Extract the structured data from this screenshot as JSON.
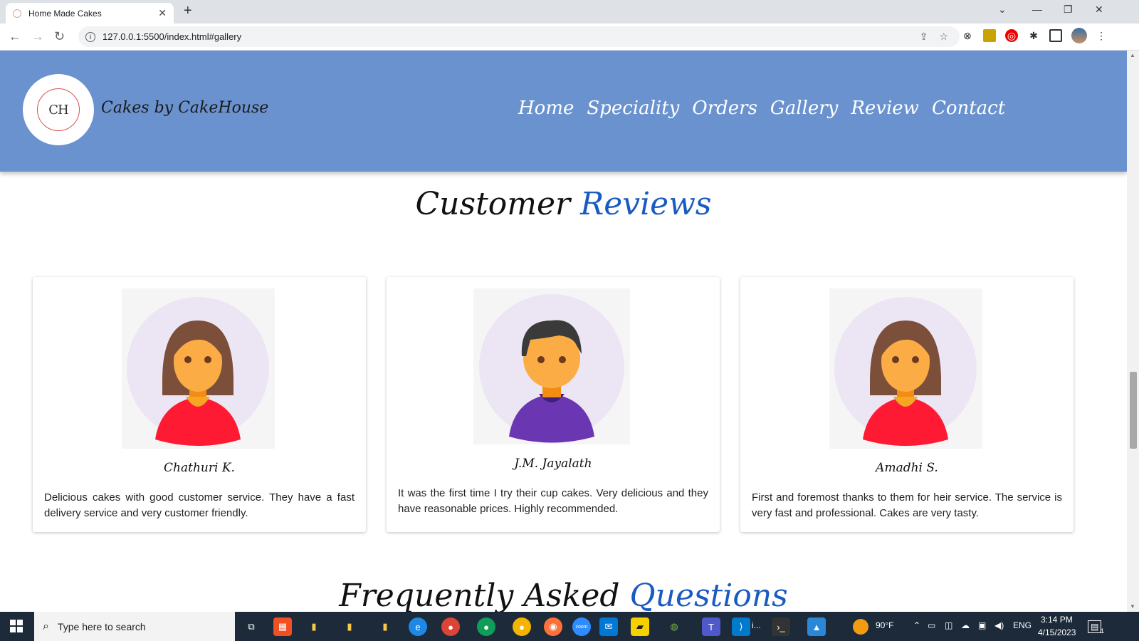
{
  "browser": {
    "tab_title": "Home Made Cakes",
    "tab_close": "✕",
    "new_tab": "+",
    "url": "127.0.0.1:5500/index.html#gallery",
    "info_glyph": "i"
  },
  "header": {
    "logo_text": "CH",
    "brand": "Cakes by CakeHouse",
    "nav": [
      "Home",
      "Speciality",
      "Orders",
      "Gallery",
      "Review",
      "Contact"
    ]
  },
  "reviews": {
    "title_main": "Customer",
    "title_accent": "Reviews",
    "cards": [
      {
        "name": "Chathuri K.",
        "text": "Delicious cakes with good customer service. They have a fast delivery service and very customer friendly.",
        "avatar": "female-avatar"
      },
      {
        "name": "J.M. Jayalath",
        "text": "It was the first time I try their cup cakes. Very delicious and they have reasonable prices. Highly recommended.",
        "avatar": "male-avatar"
      },
      {
        "name": "Amadhi S.",
        "text": "First and foremost thanks to them for heir service. The service is very fast and professional. Cakes are very tasty.",
        "avatar": "female-avatar"
      }
    ]
  },
  "faq": {
    "title_main": "Frequently Asked",
    "title_accent": "Questions"
  },
  "taskbar": {
    "search_placeholder": "Type here to search",
    "weather": "90°F",
    "language": "ENG",
    "time": "3:14 PM",
    "date": "4/15/2023",
    "teams_label": "i...",
    "notification_count": "1"
  },
  "colors": {
    "header_bg": "#6a92cf",
    "accent": "#1a5bc2"
  }
}
